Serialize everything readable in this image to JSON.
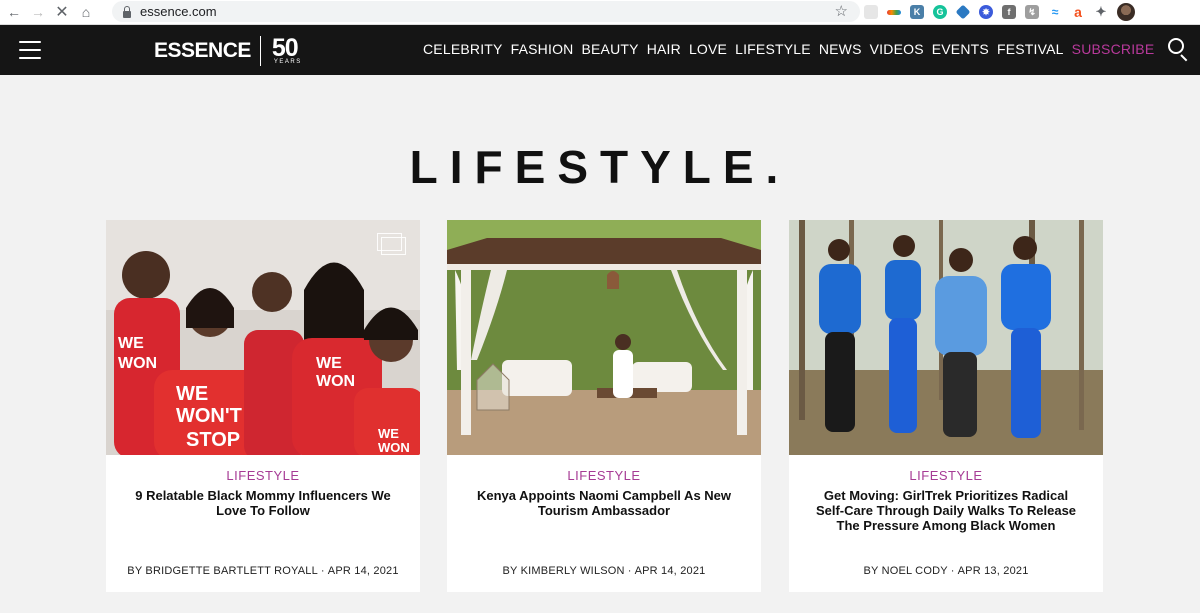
{
  "browser": {
    "url": "essence.com"
  },
  "header": {
    "logo_word": "ESSENCE",
    "logo_number": "50",
    "logo_years": "YEARS",
    "nav": [
      {
        "label": "CELEBRITY"
      },
      {
        "label": "FASHION"
      },
      {
        "label": "BEAUTY"
      },
      {
        "label": "HAIR"
      },
      {
        "label": "LOVE"
      },
      {
        "label": "LIFESTYLE"
      },
      {
        "label": "NEWS"
      },
      {
        "label": "VIDEOS"
      },
      {
        "label": "EVENTS"
      },
      {
        "label": "FESTIVAL"
      },
      {
        "label": "SUBSCRIBE"
      }
    ]
  },
  "page": {
    "title": "LIFESTYLE."
  },
  "cards": [
    {
      "category": "LIFESTYLE",
      "headline": "9 Relatable Black Mommy Influencers We Love To Follow",
      "author": "BY BRIDGETTE BARTLETT ROYALL",
      "date": "APR 14, 2021"
    },
    {
      "category": "LIFESTYLE",
      "headline": "Kenya Appoints Naomi Campbell As New Tourism Ambassador",
      "author": "BY KIMBERLY WILSON",
      "date": "APR 14, 2021"
    },
    {
      "category": "LIFESTYLE",
      "headline": "Get Moving: GirlTrek Prioritizes Radical Self-Care Through Daily Walks To Release The Pressure Among Black Women",
      "author": "BY NOEL CODY",
      "date": "APR 13, 2021"
    }
  ],
  "colors": {
    "header_bg": "#151515",
    "subscribe": "#b8399b",
    "category": "#a63b95",
    "page_bg": "#f2f2f2"
  }
}
